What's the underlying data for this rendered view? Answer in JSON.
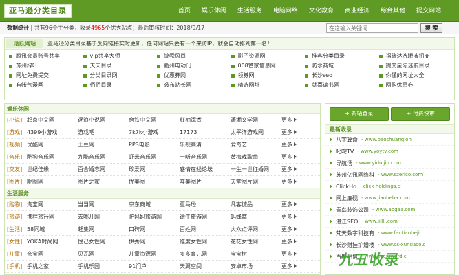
{
  "header": {
    "logo": "亚马逊分类目录",
    "nav": [
      "首页",
      "娱乐休闲",
      "生活服务",
      "电脑网络",
      "文化教育",
      "商业经济",
      "综合其他",
      "提交网站"
    ]
  },
  "stats": {
    "label": "数据统计",
    "sep": "|",
    "t1": " 共有",
    "categories": "96",
    "t2": "个主分类，收录",
    "sites": "4965",
    "t3": "个优秀站点；最后审核时间：",
    "date": "2018/9/17",
    "search_placeholder": "在这输入关键词",
    "search_button": "搜 索"
  },
  "featured": {
    "label": "活跃网站",
    "notice": "亚马逊分类目录基于反向链接实时更新，任何网站只要有一个来访IP，就会自动排到第一名！",
    "items": [
      "腾讯会员账号共享",
      "vip共享大师",
      "锦舜风尚",
      "影子资源网",
      "推客分类目录",
      "福瑞达洗眼液招商",
      "苏州绿叶",
      "天天目录",
      "衢州电动门",
      "008管家信息网",
      "防水商城",
      "提交星际迷航目录",
      "网址免费提交",
      "分类目录网",
      "优惠券网",
      "领券网",
      "长沙seo",
      "你懂的网址大全",
      "有帐气漫画",
      "佰佰目录",
      "袭布站长网",
      "精选网址",
      "就喜读书网",
      "网购优惠券"
    ]
  },
  "sections": [
    {
      "title": "娱乐休闲",
      "rows": [
        {
          "cat": "[小说]",
          "sites": [
            "起点中文网",
            "逐浪小说网",
            "磨铁中文网",
            "红袖添香",
            "潇湘文学网"
          ]
        },
        {
          "cat": "[游戏]",
          "sites": [
            "4399小游戏",
            "游戏吧",
            "7k7k小游戏",
            "17173",
            "太平洋游戏网"
          ]
        },
        {
          "cat": "[视频]",
          "sites": [
            "优酷网",
            "土豆网",
            "PPS电影",
            "乐视高清",
            "爱奇艺"
          ]
        },
        {
          "cat": "[音乐]",
          "sites": [
            "酷狗音乐网",
            "九酷音乐网",
            "虾米音乐网",
            "一听音乐网",
            "黄梅戏歌曲"
          ]
        },
        {
          "cat": "[交友]",
          "sites": [
            "世纪佳缘",
            "百合婚恋网",
            "珍爱网",
            "感情在线论坛",
            "一生一世征婚网"
          ]
        },
        {
          "cat": "[图片]",
          "sites": [
            "昵图网",
            "图片之家",
            "优美图",
            "唯美图片",
            "天堂图片网"
          ]
        }
      ]
    },
    {
      "title": "生活服务",
      "rows": [
        {
          "cat": "[购物]",
          "sites": [
            "淘宝网",
            "当当网",
            "京东商城",
            "亚马逊",
            "凡客诚品"
          ]
        },
        {
          "cat": "[旅游]",
          "sites": [
            "携程旅行网",
            "去哪儿网",
            "驴妈妈旅游网",
            "途牛旅游网",
            "蚂蜂窝"
          ]
        },
        {
          "cat": "[生活]",
          "sites": [
            "58同城",
            "赶集网",
            "口碑网",
            "百姓网",
            "大众点评网"
          ]
        },
        {
          "cat": "[女性]",
          "sites": [
            "YOKA时尚网",
            "悦己女性网",
            "伊秀网",
            "维度女性网",
            "花花女性网"
          ]
        },
        {
          "cat": "[儿童]",
          "sites": [
            "亲宝网",
            "贝瓦网",
            "儿童资源网",
            "多多育儿网",
            "宝宝树"
          ]
        },
        {
          "cat": "[手机]",
          "sites": [
            "手机之家",
            "手机乐园",
            "91门户",
            "天翼空间",
            "安卓市场"
          ]
        }
      ]
    }
  ],
  "more_label": "更多",
  "right": {
    "login_button": "+ 新站登录",
    "paid_button": "+ 付费快审",
    "recent_title": "最新收录",
    "recent": [
      {
        "name": "八字算命",
        "url": "www.baoshuanglon"
      },
      {
        "name": "叱咤TV",
        "url": "www.yoytv.com"
      },
      {
        "name": "导航汤",
        "url": "www.yiduijiu.com"
      },
      {
        "name": "苏州亿讯网络科",
        "url": "www.szerico.com"
      },
      {
        "name": "ClickHo",
        "url": "click-holdings.c"
      },
      {
        "name": "网上廉砚",
        "url": "www.jianbeba.com"
      },
      {
        "name": "青岛装饰公司",
        "url": "www.aogaa.com"
      },
      {
        "name": "湛江SEO",
        "url": "www.jillll.com"
      },
      {
        "name": "梵天数字科技有",
        "url": "www.fantianbeji."
      },
      {
        "name": "长沙财挂护婚楼",
        "url": "www.cs-xundaco.c"
      },
      {
        "name": "百度相信",
        "url": "www.zhejuward.c"
      }
    ]
  },
  "watermark": "九五收录"
}
